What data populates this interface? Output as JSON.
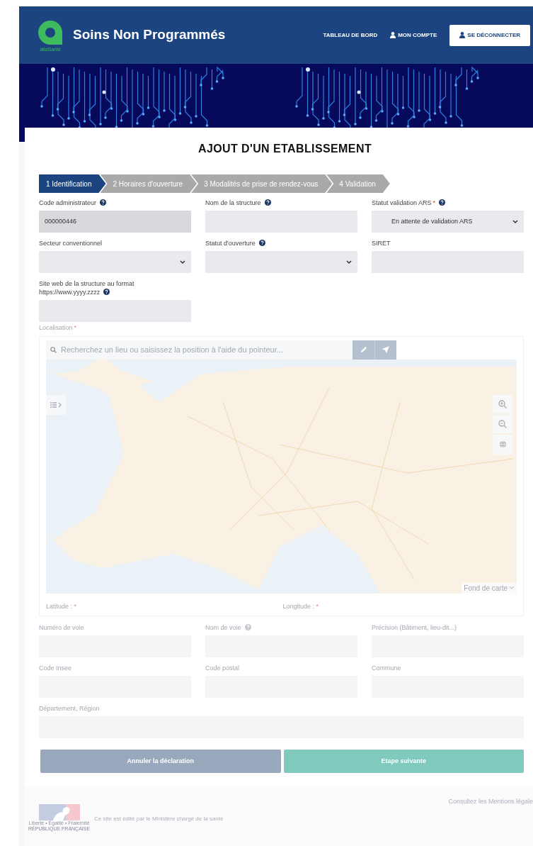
{
  "header": {
    "logo_caption": "atlaSanté",
    "app_title": "Soins Non Programmés",
    "nav": [
      {
        "label": "TABLEAU DE BORD",
        "kind": "link"
      },
      {
        "label": "MON COMPTE",
        "kind": "account"
      },
      {
        "label": "SE DÉCONNECTER",
        "kind": "logout"
      }
    ]
  },
  "page_title": "AJOUT D'UN ETABLISSEMENT",
  "steps": [
    {
      "label": "1 Identification",
      "selected": true
    },
    {
      "label": "2 Horaires d'ouverture",
      "selected": false
    },
    {
      "label": "3 Modalités de prise de rendez-vous",
      "selected": false
    },
    {
      "label": "4 Validation",
      "selected": false
    }
  ],
  "identification_rows": [
    [
      {
        "label": "Code administrateur",
        "help": true,
        "kind": "readonly",
        "value": "000000446",
        "disabled": false
      },
      {
        "label": "Nom de la structure",
        "help": true,
        "kind": "input",
        "disabled": false
      },
      {
        "label": "Statut validation ARS",
        "help": true,
        "required_mark": "*",
        "kind": "select",
        "value": "En attente de validation ARS",
        "disabled": false
      }
    ],
    [
      {
        "label": "Secteur conventionnel",
        "help": false,
        "kind": "select",
        "disabled": false
      },
      {
        "label": "Statut d'ouverture",
        "help": true,
        "kind": "select",
        "disabled": false
      },
      {
        "label": "SIRET",
        "help": false,
        "kind": "input",
        "disabled": false
      }
    ],
    [
      {
        "label": "Site web de la structure au format https://www.yyyy.zzzz",
        "help": true,
        "kind": "input",
        "disabled": false
      }
    ]
  ],
  "location": {
    "label": "Localisation",
    "required_mark": "*",
    "disabled": true,
    "search_placeholder": "Recherchez un lieu ou saisissez la position à l'aide du pointeur...",
    "basemap_label": "Fond de carte",
    "latitude_label": "Latitude :",
    "longitude_label": "Longitude :",
    "latitude_required_mark": "*",
    "longitude_required_mark": "*"
  },
  "address_rows": [
    [
      {
        "label": "Numéro de voie",
        "help": false,
        "kind": "input",
        "disabled": true
      },
      {
        "label": "Nom de voie",
        "help": true,
        "kind": "input",
        "disabled": true
      },
      {
        "label": "Précision (Bâtiment, lieu-dit...)",
        "help": false,
        "kind": "input",
        "disabled": true
      }
    ],
    [
      {
        "label": "Code Insee",
        "help": false,
        "kind": "input",
        "disabled": true
      },
      {
        "label": "Code postal",
        "help": false,
        "kind": "input",
        "disabled": true
      },
      {
        "label": "Commune",
        "help": false,
        "kind": "input",
        "disabled": true
      }
    ],
    [
      {
        "label": "Département, Région",
        "help": false,
        "kind": "wide",
        "disabled": true
      }
    ]
  ],
  "actions": [
    {
      "label": "Annuler la déclaration",
      "kind": "cancel",
      "disabled": true
    },
    {
      "label": "Etape suivante",
      "kind": "next",
      "disabled": true
    }
  ],
  "footer": {
    "legal_link": "Consultez les Mentions légale",
    "publisher": "Ce site est édité par le Ministère chargé de la santé",
    "motto": "Liberté • Égalité • Fraternité",
    "republic": "RÉPUBLIQUE FRANÇAISE"
  }
}
